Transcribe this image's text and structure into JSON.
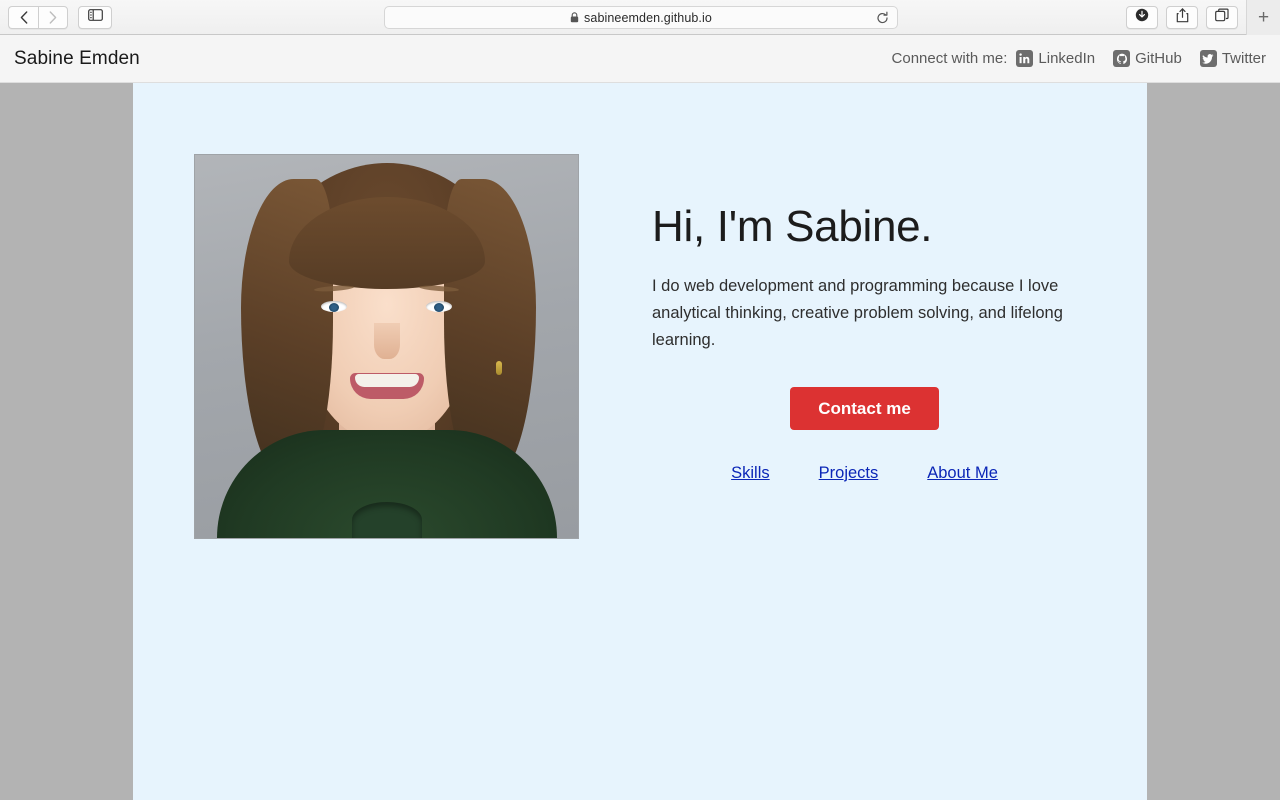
{
  "browser": {
    "back_label": "Back",
    "forward_label": "Forward",
    "sidebar_label": "Show sidebar",
    "url": "sabineemden.github.io",
    "lock_icon": "lock-icon",
    "reload_icon": "reload-icon",
    "downloads_icon": "downloads-icon",
    "share_icon": "share-icon",
    "tabs_icon": "tab-overview-icon",
    "newtab_label": "+"
  },
  "site_header": {
    "brand": "Sabine Emden",
    "connect_label": "Connect with me:",
    "social": [
      {
        "name": "LinkedIn",
        "icon": "linkedin-icon"
      },
      {
        "name": "GitHub",
        "icon": "github-icon"
      },
      {
        "name": "Twitter",
        "icon": "twitter-icon"
      }
    ]
  },
  "hero": {
    "photo_alt": "Portrait photo of Sabine Emden",
    "title": "Hi, I'm Sabine.",
    "subtitle": "I do web development and programming because I love analytical thinking, creative problem solving, and lifelong learning.",
    "cta_label": "Contact me",
    "links": [
      {
        "label": "Skills"
      },
      {
        "label": "Projects"
      },
      {
        "label": "About Me"
      }
    ]
  },
  "colors": {
    "page_backdrop": "#b3b3b3",
    "content_background": "#e7f4fd",
    "header_background": "#f5f5f5",
    "cta_red": "#dc3232",
    "link_blue": "#0b26b7",
    "heading_text": "#1c1c1c"
  }
}
